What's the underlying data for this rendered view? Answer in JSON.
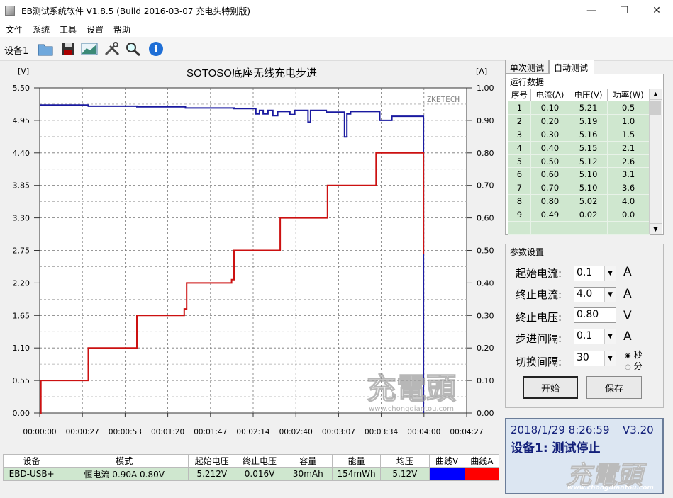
{
  "window": {
    "title": "EB测试系统软件 V1.8.5 (Build 2016-03-07 充电头特别版)",
    "min": "—",
    "max": "☐",
    "close": "✕"
  },
  "menu": [
    "文件",
    "系统",
    "工具",
    "设置",
    "帮助"
  ],
  "toolbar": {
    "device_label": "设备1",
    "icons": [
      "folder-icon",
      "save-icon",
      "chart-icon",
      "tools-icon",
      "search-icon",
      "info-icon"
    ]
  },
  "chart_data": {
    "type": "line",
    "title": "SOTOSO底座无线充电步进",
    "watermark_brand": "ZKETECH",
    "left_axis_label": "[V]",
    "right_axis_label": "[A]",
    "left_ticks": [
      "5.50",
      "4.95",
      "4.40",
      "3.85",
      "3.30",
      "2.75",
      "2.20",
      "1.65",
      "1.10",
      "0.55",
      "0.00"
    ],
    "right_ticks": [
      "1.00",
      "0.90",
      "0.80",
      "0.70",
      "0.60",
      "0.50",
      "0.40",
      "0.30",
      "0.20",
      "0.10",
      "0.00"
    ],
    "x_ticks": [
      "00:00:00",
      "00:00:27",
      "00:00:53",
      "00:01:20",
      "00:01:47",
      "00:02:14",
      "00:02:40",
      "00:03:07",
      "00:03:34",
      "00:04:00",
      "00:04:27"
    ],
    "ylim_left": [
      0,
      5.5
    ],
    "ylim_right": [
      0,
      1.0
    ],
    "xlim_seconds": [
      0,
      267
    ],
    "series": [
      {
        "name": "曲线V",
        "color": "#1a1aa0",
        "axis": "left",
        "points": [
          [
            0,
            5.21
          ],
          [
            40,
            5.21
          ],
          [
            40,
            5.19
          ],
          [
            80,
            5.19
          ],
          [
            80,
            5.18
          ],
          [
            120,
            5.18
          ],
          [
            120,
            5.16
          ],
          [
            160,
            5.16
          ],
          [
            160,
            5.15
          ],
          [
            178,
            5.15
          ],
          [
            178,
            5.06
          ],
          [
            181,
            5.06
          ],
          [
            181,
            5.12
          ],
          [
            184,
            5.12
          ],
          [
            184,
            5.06
          ],
          [
            188,
            5.06
          ],
          [
            188,
            5.12
          ],
          [
            192,
            5.12
          ],
          [
            192,
            5.03
          ],
          [
            196,
            5.03
          ],
          [
            196,
            5.1
          ],
          [
            206,
            5.1
          ],
          [
            206,
            5.05
          ],
          [
            210,
            5.05
          ],
          [
            210,
            5.12
          ],
          [
            221,
            5.12
          ],
          [
            221,
            4.92
          ],
          [
            223,
            4.92
          ],
          [
            223,
            5.12
          ],
          [
            236,
            5.12
          ],
          [
            236,
            5.09
          ],
          [
            246,
            5.09
          ],
          [
            246,
            5.09
          ],
          [
            251,
            5.09
          ],
          [
            251,
            4.67
          ],
          [
            253,
            4.67
          ],
          [
            253,
            5.06
          ],
          [
            256,
            5.06
          ],
          [
            256,
            5.1
          ],
          [
            280,
            5.1
          ],
          [
            280,
            4.95
          ],
          [
            290,
            4.95
          ],
          [
            290,
            5.02
          ],
          [
            316,
            5.02
          ],
          [
            316,
            0.0
          ]
        ]
      },
      {
        "name": "曲线A",
        "color": "#cc1111",
        "axis": "right",
        "points": [
          [
            0,
            0.0
          ],
          [
            1,
            0.0
          ],
          [
            1,
            0.1
          ],
          [
            40,
            0.1
          ],
          [
            40,
            0.2
          ],
          [
            80,
            0.2
          ],
          [
            80,
            0.3
          ],
          [
            119,
            0.3
          ],
          [
            119,
            0.32
          ],
          [
            121,
            0.32
          ],
          [
            121,
            0.4
          ],
          [
            158,
            0.4
          ],
          [
            158,
            0.41
          ],
          [
            160,
            0.41
          ],
          [
            160,
            0.5
          ],
          [
            198,
            0.5
          ],
          [
            198,
            0.6
          ],
          [
            237,
            0.6
          ],
          [
            237,
            0.7
          ],
          [
            277,
            0.7
          ],
          [
            277,
            0.8
          ],
          [
            316,
            0.8
          ],
          [
            316,
            0.49
          ]
        ]
      }
    ]
  },
  "tabs": [
    "单次测试",
    "自动测试"
  ],
  "run_data": {
    "group_title": "运行数据",
    "headers": [
      "序号",
      "电流(A)",
      "电压(V)",
      "功率(W)"
    ],
    "rows": [
      [
        "1",
        "0.10",
        "5.21",
        "0.5"
      ],
      [
        "2",
        "0.20",
        "5.19",
        "1.0"
      ],
      [
        "3",
        "0.30",
        "5.16",
        "1.5"
      ],
      [
        "4",
        "0.40",
        "5.15",
        "2.1"
      ],
      [
        "5",
        "0.50",
        "5.12",
        "2.6"
      ],
      [
        "6",
        "0.60",
        "5.10",
        "3.1"
      ],
      [
        "7",
        "0.70",
        "5.10",
        "3.6"
      ],
      [
        "8",
        "0.80",
        "5.02",
        "4.0"
      ],
      [
        "9",
        "0.49",
        "0.02",
        "0.0"
      ]
    ]
  },
  "params": {
    "group_title": "参数设置",
    "start_current_label": "起始电流:",
    "start_current": "0.1",
    "start_current_unit": "A",
    "end_current_label": "终止电流:",
    "end_current": "4.0",
    "end_current_unit": "A",
    "end_voltage_label": "终止电压:",
    "end_voltage": "0.80",
    "end_voltage_unit": "V",
    "step_label": "步进间隔:",
    "step": "0.1",
    "step_unit": "A",
    "switch_label": "切换间隔:",
    "switch": "30",
    "radio_sec": "秒",
    "radio_min": "分",
    "start_button": "开始",
    "save_button": "保存"
  },
  "status": {
    "datetime": "2018/1/29 8:26:59",
    "version": "V3.20",
    "message": "设备1: 测试停止"
  },
  "summary": {
    "headers": [
      "设备",
      "模式",
      "起始电压",
      "终止电压",
      "容量",
      "能量",
      "均压",
      "曲线V",
      "曲线A"
    ],
    "device": "EBD-USB+",
    "mode": "恒电流  0.90A  0.80V",
    "start_v": "5.212V",
    "end_v": "0.016V",
    "capacity": "30mAh",
    "energy": "154mWh",
    "avg_v": "5.12V",
    "curve_v_color": "#0000ff",
    "curve_a_color": "#ff0000"
  },
  "watermark": {
    "chart_logo": "充電頭",
    "chart_url": "www.chongdiantou.com",
    "corner_logo": "充電頭",
    "corner_url": "www.chongdiantou.com"
  }
}
